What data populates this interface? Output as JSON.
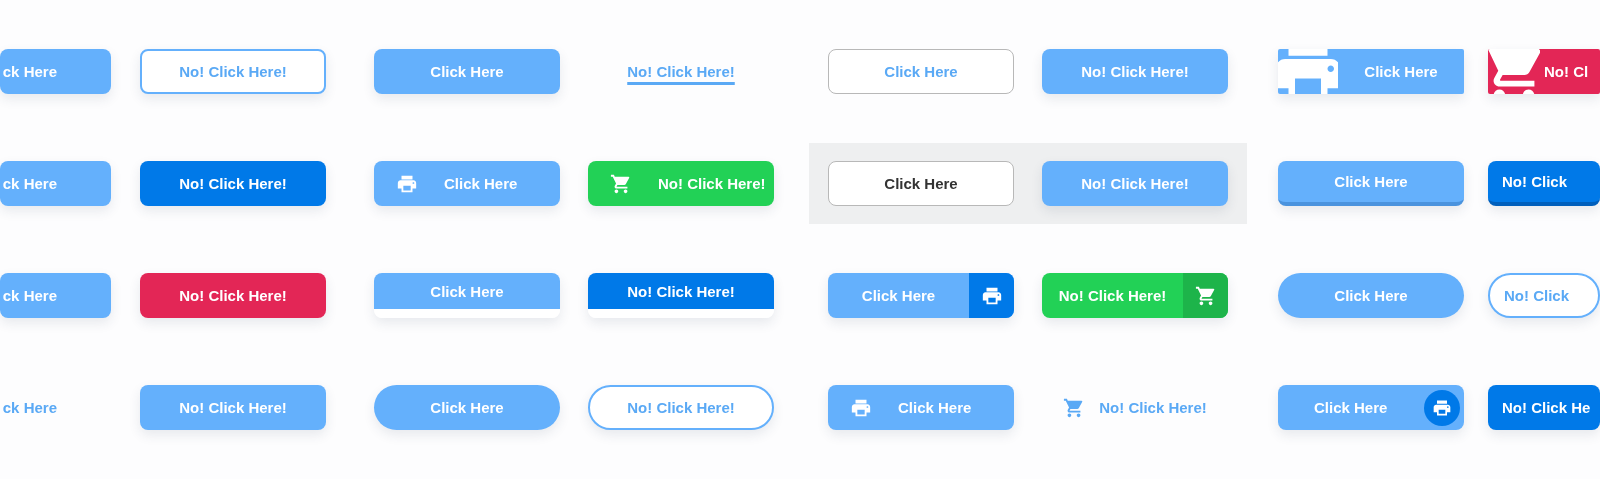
{
  "rows": [
    {
      "buttons": [
        {
          "label": "ck Here",
          "kind": "solid"
        },
        {
          "label": "No! Click Here!",
          "kind": "outline"
        },
        {
          "label": "Click Here",
          "kind": "solid"
        },
        {
          "label": "No! Click Here!",
          "kind": "link"
        },
        {
          "label": "Click Here",
          "kind": "outline-gray"
        },
        {
          "label": "No! Click Here!",
          "kind": "solid"
        },
        {
          "label": "Click Here",
          "kind": "printer-block"
        },
        {
          "label": "No! Cl",
          "kind": "cart-block"
        }
      ]
    },
    {
      "buttons": [
        {
          "label": "ck Here",
          "kind": "solid"
        },
        {
          "label": "No! Click Here!",
          "kind": "solid-dark"
        },
        {
          "label": "Click Here",
          "kind": "printer-left"
        },
        {
          "label": "No! Click Here!",
          "kind": "cart-left"
        },
        {
          "label": "Click Here",
          "kind": "outline-neutral"
        },
        {
          "label": "No! Click Here!",
          "kind": "solid"
        },
        {
          "label": "Click Here",
          "kind": "raised"
        },
        {
          "label": "No! Click",
          "kind": "raised-dark"
        }
      ]
    },
    {
      "buttons": [
        {
          "label": "ck Here",
          "kind": "solid"
        },
        {
          "label": "No! Click Here!",
          "kind": "solid-red"
        },
        {
          "label": "Click Here",
          "kind": "strip"
        },
        {
          "label": "No! Click Here!",
          "kind": "strip-dark"
        },
        {
          "label": "Click Here",
          "kind": "printer-split"
        },
        {
          "label": "No! Click Here!",
          "kind": "cart-split"
        },
        {
          "label": "Click Here",
          "kind": "pill"
        },
        {
          "label": "No! Click",
          "kind": "outline-pill"
        }
      ]
    },
    {
      "buttons": [
        {
          "label": "ck Here",
          "kind": "ghost"
        },
        {
          "label": "No! Click Here!",
          "kind": "solid"
        },
        {
          "label": "Click Here",
          "kind": "pill"
        },
        {
          "label": "No! Click Here!",
          "kind": "outline-pill"
        },
        {
          "label": "Click Here",
          "kind": "printer-left"
        },
        {
          "label": "No! Click Here!",
          "kind": "cart-ghost"
        },
        {
          "label": "Click Here",
          "kind": "printer-badge"
        },
        {
          "label": "No! Click He",
          "kind": "solid-dark"
        }
      ]
    }
  ]
}
